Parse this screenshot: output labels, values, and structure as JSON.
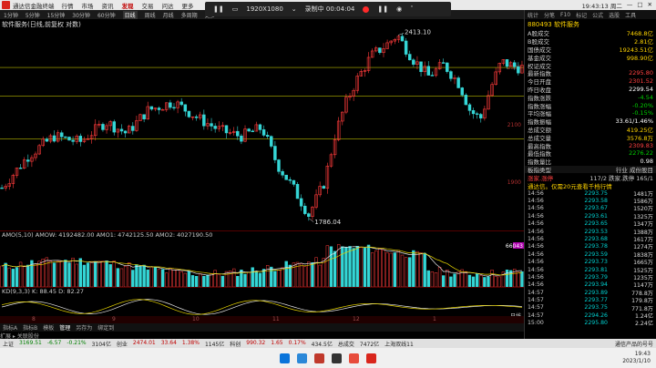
{
  "app": {
    "name": "通达信金融终端",
    "menu": [
      "行情",
      "市场",
      "资讯",
      "发现",
      "交易",
      "问达",
      "更多"
    ],
    "active_menu": "发现",
    "window_time": "19:43:13 周二",
    "window_controls": [
      "minimize",
      "maximize",
      "close"
    ]
  },
  "recording": {
    "resolution": "1920X1080",
    "status_label": "录制中",
    "elapsed": "00:04:04"
  },
  "period_bar": {
    "items": [
      "1分钟",
      "5分钟",
      "15分钟",
      "30分钟",
      "60分钟",
      "日线",
      "周线",
      "月线",
      "多周期",
      "更多"
    ],
    "active": "日线"
  },
  "chart": {
    "title": "软件服务(日线,前复权 对数)",
    "high_label": "2413.10",
    "low_label": "1786.04",
    "y_ticks": [
      "2300",
      "2100",
      "1900"
    ],
    "x_ticks": [
      "8",
      "9",
      "10",
      "11",
      "12",
      "1"
    ],
    "vol_title": "AMO(5,10) AMOW: 4192482.00 AMO1: 4742125.50 AMO2: 4027190.50",
    "vol_marker": "66043",
    "kdj_title": "KD(9,3,3) K: 88.45 D: 82.27",
    "kdj_marker": "日线"
  },
  "chart_data": {
    "type": "candlestick",
    "title": "软件服务(日线,前复权 对数)",
    "annotations": [
      {
        "label": "2413.10",
        "kind": "high"
      },
      {
        "label": "1786.04",
        "kind": "low"
      }
    ],
    "ylim": [
      1760,
      2440
    ],
    "last_close": 2295.8
  },
  "bottom_tabs": [
    "指标A",
    "指标B",
    "模板",
    "管理",
    "另存为",
    "绑定到"
  ],
  "bottom_tabs_active": "管理",
  "news_line": "扩展 ▸  关联股份",
  "right_panel": {
    "tabs": [
      "统计",
      "分笔",
      "F10",
      "标记",
      "公式",
      "选股",
      "工具"
    ],
    "title_code": "880493",
    "title_name": "软件服务",
    "stats": [
      {
        "label": "A股成交",
        "value": "7468.8亿",
        "color": "#ffd400"
      },
      {
        "label": "B股成交",
        "value": "2.81亿",
        "color": "#ffd400"
      },
      {
        "label": "国债成交",
        "value": "19243.51亿",
        "color": "#ffd400"
      },
      {
        "label": "基金成交",
        "value": "998.90亿",
        "color": "#ffd400"
      },
      {
        "label": "权证成交",
        "value": "",
        "color": "#ffd400"
      },
      {
        "label": "最新指数",
        "value": "2295.80",
        "color": "#ff4040"
      },
      {
        "label": "今日开盘",
        "value": "2301.52",
        "color": "#ff4040"
      },
      {
        "label": "昨日收盘",
        "value": "2299.54",
        "color": "#ffffff"
      },
      {
        "label": "指数涨跌",
        "value": "-4.54",
        "color": "#00d000"
      },
      {
        "label": "指数涨幅",
        "value": "-0.20%",
        "color": "#00d000"
      },
      {
        "label": "平均涨幅",
        "value": "-0.15%",
        "color": "#00d000"
      },
      {
        "label": "指数振幅",
        "value": "33.61/1.46%",
        "color": "#ffffff"
      },
      {
        "label": "总成交额",
        "value": "419.25亿",
        "color": "#ffd400"
      },
      {
        "label": "总成交量",
        "value": "3576.8万",
        "color": "#ffd400"
      },
      {
        "label": "最高指数",
        "value": "2309.83",
        "color": "#ff4040"
      },
      {
        "label": "最低指数",
        "value": "2276.22",
        "color": "#00d000"
      },
      {
        "label": "指数量比",
        "value": "0.98",
        "color": "#ffffff"
      }
    ],
    "board_label": "板指类型",
    "board_value": "行业 成份股目",
    "updown_label": "涨家.涨停",
    "updown_value": "117/2 跌家.跌停 165/1",
    "promo": "通达信。仅需20元查看千档行情",
    "ticks": [
      {
        "t": "14:56",
        "p": "2293.75",
        "v": "1481万"
      },
      {
        "t": "14:56",
        "p": "2293.58",
        "v": "1586万"
      },
      {
        "t": "14:56",
        "p": "2293.67",
        "v": "1520万"
      },
      {
        "t": "14:56",
        "p": "2293.61",
        "v": "1325万"
      },
      {
        "t": "14:56",
        "p": "2293.65",
        "v": "1347万"
      },
      {
        "t": "14:56",
        "p": "2293.53",
        "v": "1388万"
      },
      {
        "t": "14:56",
        "p": "2293.68",
        "v": "1617万"
      },
      {
        "t": "14:56",
        "p": "2293.78",
        "v": "1274万"
      },
      {
        "t": "14:56",
        "p": "2293.59",
        "v": "1838万"
      },
      {
        "t": "14:56",
        "p": "2293.73",
        "v": "1665万"
      },
      {
        "t": "14:56",
        "p": "2293.81",
        "v": "1525万"
      },
      {
        "t": "14:56",
        "p": "2293.79",
        "v": "1235万"
      },
      {
        "t": "14:56",
        "p": "2293.94",
        "v": "1147万"
      },
      {
        "t": "14:57",
        "p": "2293.89",
        "v": "778.8万"
      },
      {
        "t": "14:57",
        "p": "2293.77",
        "v": "179.8万"
      },
      {
        "t": "14:57",
        "p": "2293.75",
        "v": "771.8万"
      },
      {
        "t": "14:57",
        "p": "2294.26",
        "v": "1.24亿"
      },
      {
        "t": "15:00",
        "p": "2295.80",
        "v": "2.24亿"
      }
    ]
  },
  "status_bar": {
    "items": [
      {
        "text": "上证",
        "cls": ""
      },
      {
        "text": "3169.51",
        "cls": "down"
      },
      {
        "text": "-6.57",
        "cls": "down"
      },
      {
        "text": "-0.21%",
        "cls": "down"
      },
      {
        "text": "3104亿",
        "cls": ""
      },
      {
        "text": "创业",
        "cls": ""
      },
      {
        "text": "2474.01",
        "cls": "up"
      },
      {
        "text": "33.64",
        "cls": "up"
      },
      {
        "text": "1.38%",
        "cls": "up"
      },
      {
        "text": "1145亿",
        "cls": ""
      },
      {
        "text": "科创",
        "cls": ""
      },
      {
        "text": "990.32",
        "cls": "up"
      },
      {
        "text": "1.65",
        "cls": "up"
      },
      {
        "text": "0.17%",
        "cls": "up"
      },
      {
        "text": "434.5亿",
        "cls": ""
      },
      {
        "text": "总成交",
        "cls": ""
      },
      {
        "text": "7472亿",
        "cls": ""
      },
      {
        "text": "上海双线11",
        "cls": ""
      }
    ],
    "right_text": "通信产品的号号"
  },
  "taskbar": {
    "time": "19:43",
    "date": "2023/1/10"
  }
}
